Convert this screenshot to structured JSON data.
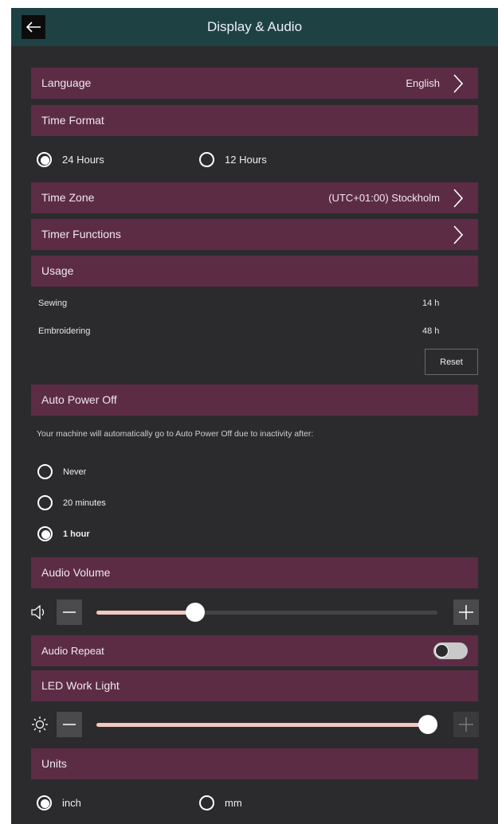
{
  "header": {
    "title": "Display & Audio"
  },
  "language": {
    "label": "Language",
    "value": "English"
  },
  "time_format": {
    "label": "Time Format",
    "options": [
      "24 Hours",
      "12 Hours"
    ],
    "selected": "24 Hours"
  },
  "time_zone": {
    "label": "Time Zone",
    "value": "(UTC+01:00) Stockholm"
  },
  "timer_functions": {
    "label": "Timer Functions"
  },
  "usage": {
    "label": "Usage",
    "rows": [
      {
        "name": "Sewing",
        "value": "14 h"
      },
      {
        "name": "Embroidering",
        "value": "48 h"
      }
    ],
    "reset_label": "Reset"
  },
  "auto_power_off": {
    "label": "Auto Power Off",
    "description": "Your machine will automatically go to Auto Power Off due to inactivity after:",
    "options": [
      "Never",
      "20 minutes",
      "1 hour"
    ],
    "selected": "1 hour"
  },
  "audio_volume": {
    "label": "Audio Volume",
    "level": 0.29
  },
  "audio_repeat": {
    "label": "Audio Repeat",
    "enabled": false
  },
  "led_work_light": {
    "label": "LED Work Light",
    "level": 1.0
  },
  "units": {
    "label": "Units",
    "options": [
      "inch",
      "mm"
    ],
    "selected": "inch"
  },
  "colors": {
    "header": "#1e4244",
    "section": "#5c2c45",
    "background": "#2b2b2d",
    "slider_fill": "#f0c8c0"
  },
  "icons": [
    "arrow-left-icon",
    "chevron-right-icon",
    "speaker-icon",
    "minus-icon",
    "plus-icon",
    "sun-icon"
  ]
}
